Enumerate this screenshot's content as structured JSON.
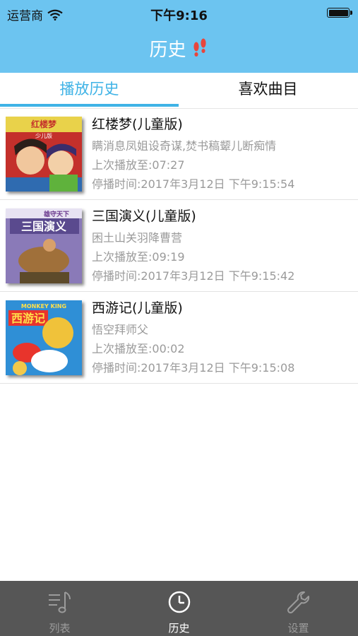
{
  "status_bar": {
    "carrier": "运营商",
    "time": "下午9:16",
    "battery_level": 1.0
  },
  "nav": {
    "title": "历史"
  },
  "tabs": [
    {
      "label": "播放历史",
      "active": true
    },
    {
      "label": "喜欢曲目",
      "active": false
    }
  ],
  "items": [
    {
      "title": "红楼梦(儿童版)",
      "subtitle": "瞒消息凤姐设奇谋,焚书稿颦儿断痴情",
      "progress": "上次播放至:07:27",
      "stopped": "停播时间:2017年3月12日 下午9:15:54",
      "cover_title": "红楼梦",
      "cover_sub": "少儿版"
    },
    {
      "title": "三国演义(儿童版)",
      "subtitle": "困土山关羽降曹营",
      "progress": "上次播放至:09:19",
      "stopped": "停播时间:2017年3月12日 下午9:15:42",
      "cover_title": "三国演义",
      "cover_sub": "雄守天下"
    },
    {
      "title": "西游记(儿童版)",
      "subtitle": "悟空拜师父",
      "progress": "上次播放至:00:02",
      "stopped": "停播时间:2017年3月12日 下午9:15:08",
      "cover_title": "西游记",
      "cover_sub": "MONKEY KING"
    }
  ],
  "tabbar": [
    {
      "label": "列表",
      "icon": "music-list-icon",
      "active": false
    },
    {
      "label": "历史",
      "icon": "clock-icon",
      "active": true
    },
    {
      "label": "设置",
      "icon": "wrench-icon",
      "active": false
    }
  ],
  "colors": {
    "header": "#6cc4f0",
    "accent": "#3fb3e6",
    "tabbar": "#565656"
  }
}
